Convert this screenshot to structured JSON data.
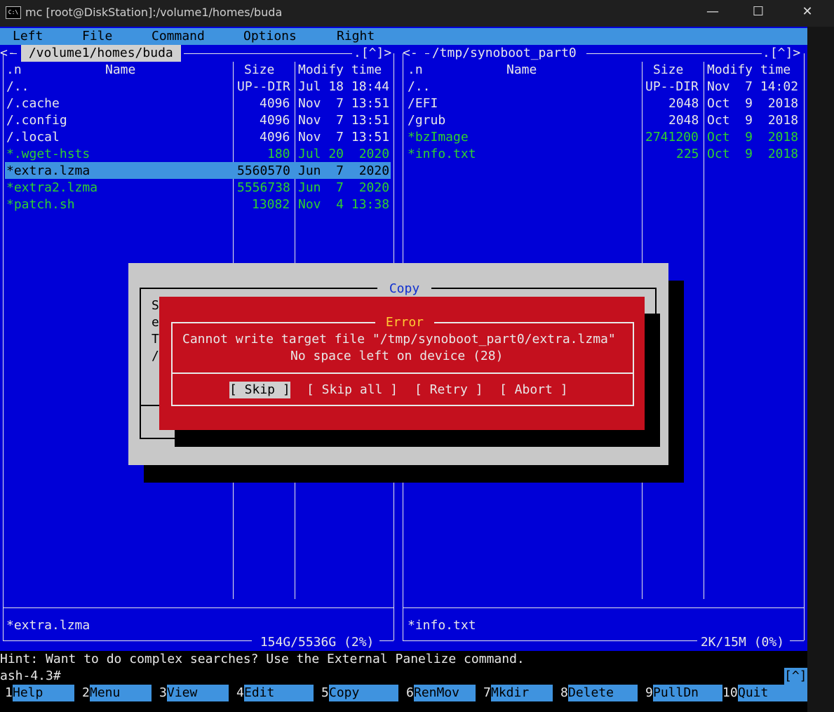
{
  "window": {
    "icon_text": "C:\\",
    "title": "mc [root@DiskStation]:/volume1/homes/buda",
    "minimize": "—",
    "maximize": "☐",
    "close": "✕"
  },
  "menu": [
    "Left",
    "File",
    "Command",
    "Options",
    "Right"
  ],
  "left_panel": {
    "frame_left": "<-",
    "path": " /volume1/homes/buda ",
    "frame_right": ".[^]>",
    "headers": {
      "sort": ".n",
      "name": "Name",
      "size": "Size",
      "time": "Modify time"
    },
    "rows": [
      {
        "name": "/..",
        "size": "UP--DIR",
        "date": "Jul 18 18:44"
      },
      {
        "name": "/.cache",
        "size": "4096",
        "date": "Nov  7 13:51"
      },
      {
        "name": "/.config",
        "size": "4096",
        "date": "Nov  7 13:51"
      },
      {
        "name": "/.local",
        "size": "4096",
        "date": "Nov  7 13:51"
      },
      {
        "name": "*.wget-hsts",
        "size": "180",
        "date": "Jul 20  2020"
      },
      {
        "name": "*extra.lzma",
        "size": "5560570",
        "date": "Jun  7  2020"
      },
      {
        "name": "*extra2.lzma",
        "size": "5556738",
        "date": "Jun  7  2020"
      },
      {
        "name": "*patch.sh",
        "size": "13082",
        "date": "Nov  4 13:38"
      }
    ],
    "status": "*extra.lzma",
    "free": " 154G/5536G (2%) "
  },
  "right_panel": {
    "frame_left": "<-",
    "path": " /tmp/synoboot_part0 ",
    "frame_right": ".[^]>",
    "headers": {
      "sort": ".n",
      "name": "Name",
      "size": "Size",
      "time": "Modify time"
    },
    "rows": [
      {
        "name": "/..",
        "size": "UP--DIR",
        "date": "Nov  7 14:02"
      },
      {
        "name": "/EFI",
        "size": "2048",
        "date": "Oct  9  2018"
      },
      {
        "name": "/grub",
        "size": "2048",
        "date": "Oct  9  2018"
      },
      {
        "name": "*bzImage",
        "size": "2741200",
        "date": "Oct  9  2018"
      },
      {
        "name": "*info.txt",
        "size": "225",
        "date": "Oct  9  2018"
      }
    ],
    "status": "*info.txt",
    "free": " 2K/15M (0%) "
  },
  "copy_dialog": {
    "title": " Copy ",
    "partial_lines": [
      "S",
      "e",
      "T",
      "/"
    ]
  },
  "error_dialog": {
    "title": " Error ",
    "line1": "Cannot write target file \"/tmp/synoboot_part0/extra.lzma\"",
    "line2": "No space left on device (28)",
    "buttons": {
      "skip": "[ Skip ]",
      "skip_all": "[ Skip all ]",
      "retry": "[ Retry ]",
      "abort": "[ Abort ]"
    }
  },
  "hint": "Hint: Want to do complex searches? Use the External Panelize command.",
  "prompt": "ash-4.3#",
  "prompt_marker": "[^]",
  "fkeys": [
    {
      "num": "1",
      "label": "Help"
    },
    {
      "num": "2",
      "label": "Menu"
    },
    {
      "num": "3",
      "label": "View"
    },
    {
      "num": "4",
      "label": "Edit"
    },
    {
      "num": "5",
      "label": "Copy"
    },
    {
      "num": "6",
      "label": "RenMov"
    },
    {
      "num": "7",
      "label": "Mkdir"
    },
    {
      "num": "8",
      "label": "Delete"
    },
    {
      "num": "9",
      "label": "PullDn"
    },
    {
      "num": "10",
      "label": "Quit"
    }
  ],
  "colors": {
    "panel_bg": "#0000d7",
    "menu_bg": "#3f93df",
    "exec_file": "#2fd02f",
    "error_bg": "#c4101e",
    "dialog_bg": "#c8c8c8"
  }
}
